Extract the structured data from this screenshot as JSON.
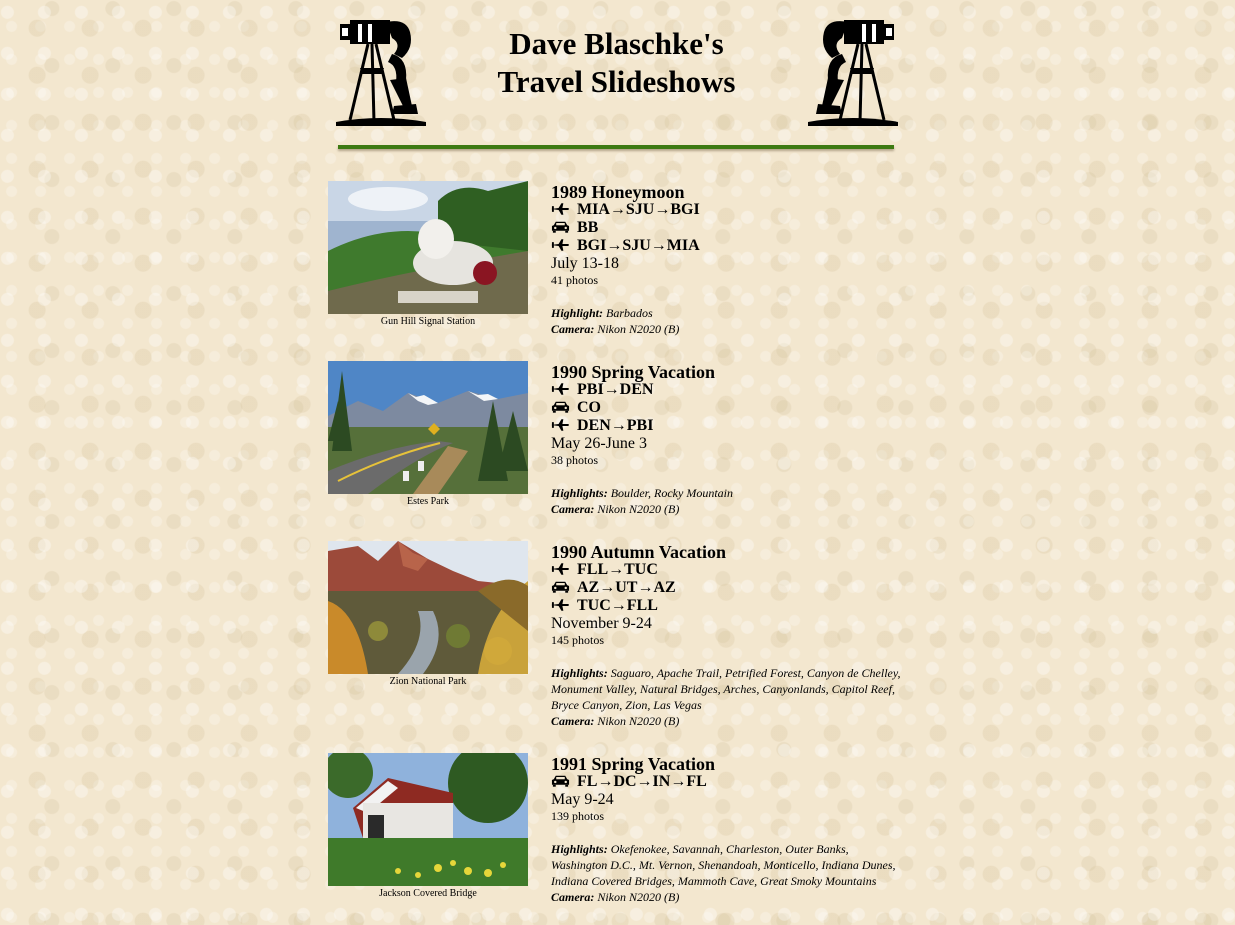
{
  "site": {
    "title_line1": "Dave Blaschke's",
    "title_line2": "Travel Slideshows",
    "accent_color": "#3d7a12",
    "header_icon": "vintage-photographer-icon"
  },
  "legend_icons": {
    "fly": "airplane-icon",
    "drive": "car-icon"
  },
  "trips": [
    {
      "title": "1989 Honeymoon",
      "legs": [
        {
          "icon": "airplane-icon",
          "route": "MIA→SJU→BGI"
        },
        {
          "icon": "car-icon",
          "route": "BB"
        },
        {
          "icon": "airplane-icon",
          "route": "BGI→SJU→MIA"
        }
      ],
      "dates": "July 13-18",
      "photos": "41 photos",
      "highlight_label": "Highlight:",
      "highlights": "Barbados",
      "camera_label": "Camera:",
      "camera": "Nikon N2020 (B)",
      "caption": "Gun Hill Signal Station"
    },
    {
      "title": "1990 Spring Vacation",
      "legs": [
        {
          "icon": "airplane-icon",
          "route": "PBI→DEN"
        },
        {
          "icon": "car-icon",
          "route": "CO"
        },
        {
          "icon": "airplane-icon",
          "route": "DEN→PBI"
        }
      ],
      "dates": "May 26-June 3",
      "photos": "38 photos",
      "highlight_label": "Highlights:",
      "highlights": "Boulder, Rocky Mountain",
      "camera_label": "Camera:",
      "camera": "Nikon N2020 (B)",
      "caption": "Estes Park"
    },
    {
      "title": "1990 Autumn Vacation",
      "legs": [
        {
          "icon": "airplane-icon",
          "route": "FLL→TUC"
        },
        {
          "icon": "car-icon",
          "route": "AZ→UT→AZ"
        },
        {
          "icon": "airplane-icon",
          "route": "TUC→FLL"
        }
      ],
      "dates": "November 9-24",
      "photos": "145 photos",
      "highlight_label": "Highlights:",
      "highlights": "Saguaro, Apache Trail, Petrified Forest, Canyon de Chelley, Monument Valley, Natural Bridges, Arches, Canyonlands, Capitol Reef, Bryce Canyon, Zion, Las Vegas",
      "camera_label": "Camera:",
      "camera": "Nikon N2020 (B)",
      "caption": "Zion National Park"
    },
    {
      "title": "1991 Spring Vacation",
      "legs": [
        {
          "icon": "car-icon",
          "route": "FL→DC→IN→FL"
        }
      ],
      "dates": "May 9-24",
      "photos": "139 photos",
      "highlight_label": "Highlights:",
      "highlights": "Okefenokee, Savannah, Charleston, Outer Banks, Washington D.C., Mt. Vernon, Shenandoah, Monticello, Indiana Dunes, Indiana Covered Bridges, Mammoth Cave, Great Smoky Mountains",
      "camera_label": "Camera:",
      "camera": "Nikon N2020 (B)",
      "caption": "Jackson Covered Bridge"
    }
  ]
}
